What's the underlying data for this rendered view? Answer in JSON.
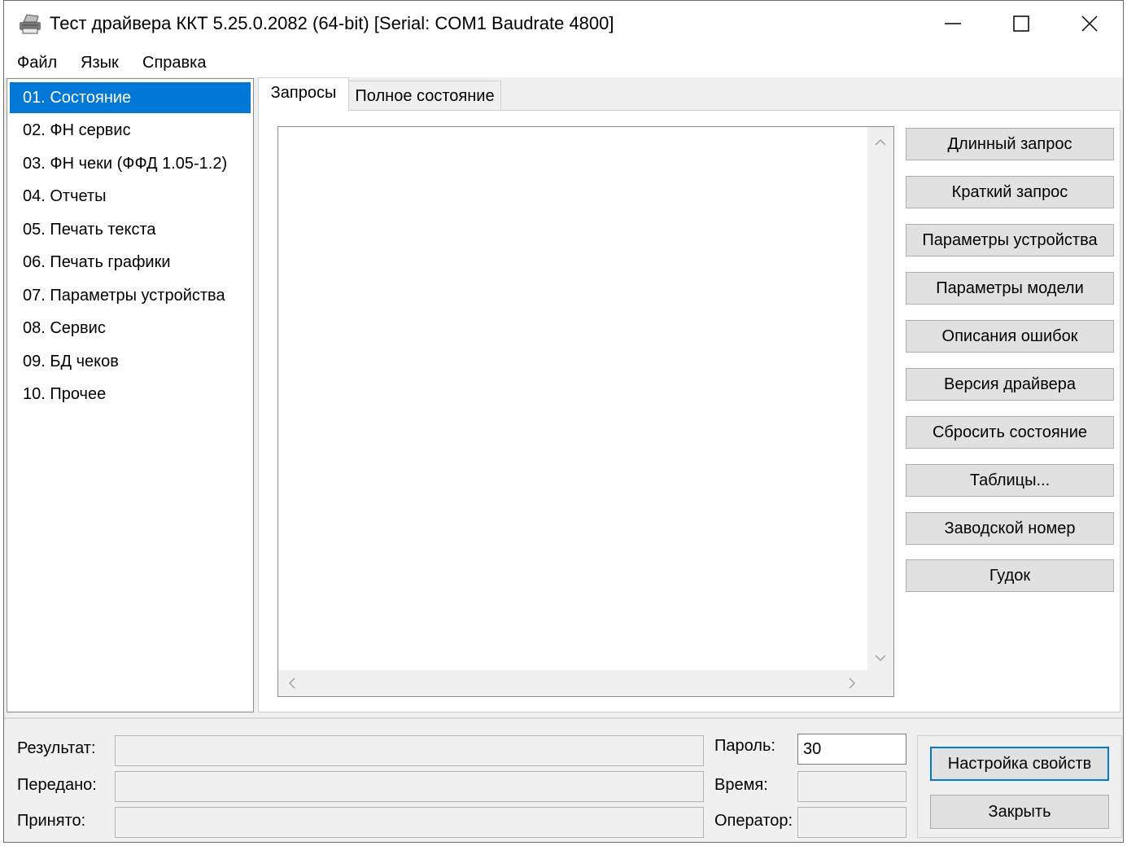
{
  "window": {
    "title": "Тест драйвера ККТ 5.25.0.2082 (64-bit) [Serial: COM1 Baudrate 4800]"
  },
  "menu": [
    "Файл",
    "Язык",
    "Справка"
  ],
  "nav": {
    "items": [
      "01. Состояние",
      "02. ФН сервис",
      "03. ФН чеки (ФФД 1.05-1.2)",
      "04. Отчеты",
      "05. Печать текста",
      "06. Печать графики",
      "07. Параметры устройства",
      "08. Сервис",
      "09. БД чеков",
      "10. Прочее"
    ],
    "selected_index": 0
  },
  "tabs": [
    "Запросы",
    "Полное состояние"
  ],
  "buttons": [
    "Длинный запрос",
    "Краткий запрос",
    "Параметры устройства",
    "Параметры модели",
    "Описания ошибок",
    "Версия драйвера",
    "Сбросить состояние",
    "Таблицы...",
    "Заводской номер",
    "Гудок"
  ],
  "status": {
    "result_label": "Результат:",
    "sent_label": "Передано:",
    "received_label": "Принято:",
    "password_label": "Пароль:",
    "password_value": "30",
    "time_label": "Время:",
    "operator_label": "Оператор:"
  },
  "bottom_buttons": {
    "settings": "Настройка свойств",
    "close": "Закрыть"
  },
  "colors": {
    "selection": "#0078d7",
    "window_bg": "#f0f0f0",
    "button_bg": "#e1e1e1"
  }
}
